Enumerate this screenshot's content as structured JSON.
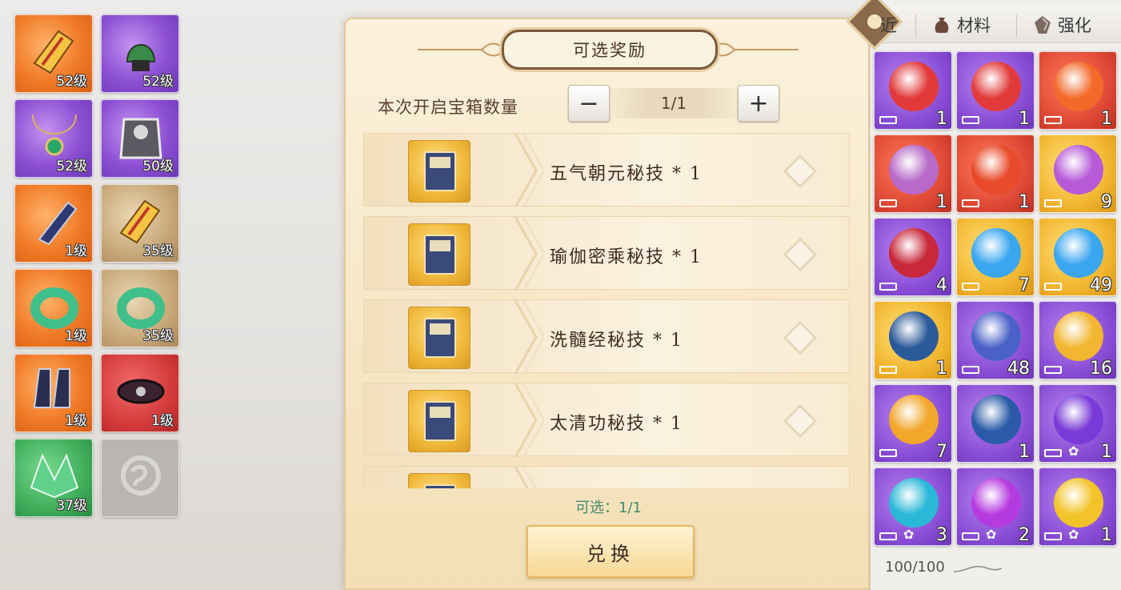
{
  "equipment": [
    {
      "level": "52级",
      "quality": "q-orange",
      "icon": "gauntlet-icon"
    },
    {
      "level": "52级",
      "quality": "q-purple",
      "icon": "helmet-icon"
    },
    {
      "level": "52级",
      "quality": "q-purple",
      "icon": "necklace-icon"
    },
    {
      "level": "50级",
      "quality": "q-purple",
      "icon": "armor-icon"
    },
    {
      "level": "1级",
      "quality": "q-orange",
      "icon": "bracer-icon"
    },
    {
      "level": "35级",
      "quality": "q-tan",
      "icon": "gauntlet-icon"
    },
    {
      "level": "1级",
      "quality": "q-orange",
      "icon": "jade-ring-icon"
    },
    {
      "level": "35级",
      "quality": "q-tan",
      "icon": "jade-ring-icon"
    },
    {
      "level": "1级",
      "quality": "q-orange",
      "icon": "boots-icon"
    },
    {
      "level": "1级",
      "quality": "q-red",
      "icon": "belt-icon"
    },
    {
      "level": "37级",
      "quality": "q-green",
      "icon": "shoulder-icon"
    },
    {
      "level": "",
      "quality": "q-empty",
      "icon": "empty-slot-icon"
    }
  ],
  "panel": {
    "title": "可选奖励",
    "count_label": "本次开启宝箱数量",
    "minus": "−",
    "plus": "+",
    "count_value": "1/1",
    "rewards": [
      {
        "name": "五气朝元秘技 * 1",
        "icon": "scroll-book-icon"
      },
      {
        "name": "瑜伽密乘秘技 * 1",
        "icon": "treasure-box-icon"
      },
      {
        "name": "洗髓经秘技 * 1",
        "icon": "bottle-scroll-icon"
      },
      {
        "name": "太清功秘技 * 1",
        "icon": "books-icon"
      },
      {
        "name": "",
        "icon": "book-icon"
      }
    ],
    "selected_text": "可选：1/1",
    "exchange_label": "兑换"
  },
  "bag": {
    "tabs": [
      {
        "label": "近",
        "icon": "recent-icon"
      },
      {
        "label": "材料",
        "icon": "material-pouch-icon"
      },
      {
        "label": "强化",
        "icon": "enhance-stone-icon"
      }
    ],
    "items": [
      {
        "count": "1",
        "quality": "b-purple",
        "orb": "#e23a3a",
        "icon": "red-scroll-icon",
        "lock": true
      },
      {
        "count": "1",
        "quality": "b-purple",
        "orb": "#e23a3a",
        "icon": "red-scroll-icon",
        "lock": true
      },
      {
        "count": "1",
        "quality": "b-red",
        "orb": "#f26a2a",
        "icon": "fire-orb-icon",
        "lock": true
      },
      {
        "count": "1",
        "quality": "b-red",
        "orb": "#b76ac8",
        "icon": "lotus-orb-icon",
        "lock": true
      },
      {
        "count": "1",
        "quality": "b-red",
        "orb": "#e84a2a",
        "icon": "flame-orb-icon",
        "lock": true
      },
      {
        "count": "9",
        "quality": "b-gold",
        "orb": "#b65ad8",
        "icon": "purple-crystal-chest-icon",
        "lock": true
      },
      {
        "count": "4",
        "quality": "b-purple",
        "orb": "#c8283a",
        "icon": "knot-charm-icon",
        "lock": true
      },
      {
        "count": "7",
        "quality": "b-gold",
        "orb": "#3aa6f0",
        "icon": "blue-spirit-stone-icon",
        "lock": true
      },
      {
        "count": "49",
        "quality": "b-gold",
        "orb": "#3aa6f0",
        "icon": "blue-spirit-stone-icon",
        "lock": true
      },
      {
        "count": "1",
        "quality": "b-gold",
        "orb": "#2b5a9a",
        "icon": "secret-manual-chest-icon",
        "lock": true
      },
      {
        "count": "48",
        "quality": "b-purple",
        "orb": "#4a62c8",
        "icon": "manual-chest-icon",
        "lock": true
      },
      {
        "count": "16",
        "quality": "b-purple",
        "orb": "#f2b630",
        "icon": "golden-pearl-chest-icon",
        "lock": true
      },
      {
        "count": "7",
        "quality": "b-purple",
        "orb": "#f2a62a",
        "icon": "golden-swirl-orb-icon",
        "lock": true
      },
      {
        "count": "1",
        "quality": "b-purple",
        "orb": "#2a5aa8",
        "icon": "beast-mask-icon",
        "lock": false
      },
      {
        "count": "1",
        "quality": "b-purple",
        "orb": "#7a3ad8",
        "icon": "purple-slash-orb-icon",
        "lock": true,
        "paw": true
      },
      {
        "count": "3",
        "quality": "b-purple",
        "orb": "#2ab8d8",
        "icon": "wolf-spirit-orb-icon",
        "lock": true,
        "paw": true
      },
      {
        "count": "2",
        "quality": "b-purple",
        "orb": "#b53ae0",
        "icon": "purple-vortex-orb-icon",
        "lock": true,
        "paw": true
      },
      {
        "count": "1",
        "quality": "b-purple",
        "orb": "#f2c42a",
        "icon": "golden-ring-orb-icon",
        "lock": true,
        "paw": true
      }
    ],
    "capacity": "100/100"
  }
}
